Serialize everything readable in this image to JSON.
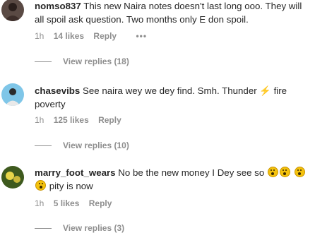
{
  "comments": [
    {
      "username": "nomso837",
      "text": "This new Naira notes doesn't last long ooo. They will all spoil ask question. Two months only E don spoil.",
      "time": "1h",
      "likes": "14 likes",
      "reply": "Reply",
      "more": "•••",
      "view_replies": "View replies (18)"
    },
    {
      "username": "chasevibs",
      "text_before": "See naira wey we dey find. Smh. Thunder ",
      "emoji": "⚡",
      "text_after": " fire poverty",
      "time": "1h",
      "likes": "125 likes",
      "reply": "Reply",
      "view_replies": "View replies (10)"
    },
    {
      "username": "marry_foot_wears",
      "text_before": "No be the new money I Dey see so ",
      "emoji_name": "astonished-face-icon",
      "text_after": " pity is now",
      "time": "1h",
      "likes": "5 likes",
      "reply": "Reply",
      "view_replies": "View replies (3)"
    }
  ]
}
